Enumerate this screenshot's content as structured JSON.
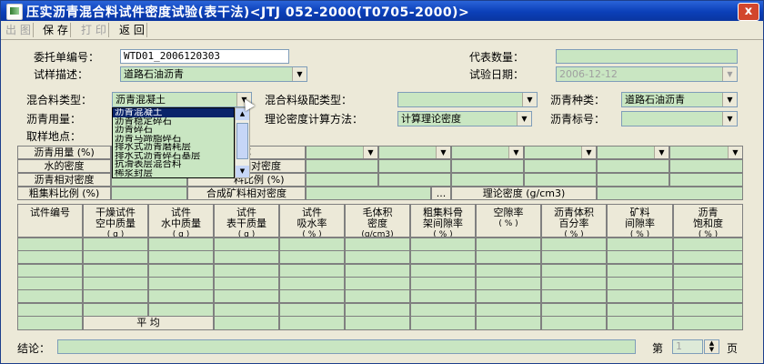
{
  "window": {
    "title": "压实沥青混合料试件密度试验(表干法)<JTJ 052-2000(T0705-2000)>",
    "close": "x"
  },
  "toolbar": {
    "out": "出 图",
    "save": "保 存",
    "print": "打 印",
    "back": "返 回"
  },
  "form": {
    "wt_label": "委托单编号：",
    "wt_value": "WTD01_2006120303",
    "desc_label": "试样描述：",
    "desc_value": "道路石油沥青",
    "rep_label": "代表数量：",
    "rep_value": "",
    "date_label": "试验日期：",
    "date_value": "2006-12-12",
    "mix_type_label": "混合料类型：",
    "mix_type_value": "沥青混凝土",
    "grade_label": "混合料级配类型：",
    "grade_value": "",
    "asp_kind_label": "沥青种类：",
    "asp_kind_value": "道路石油沥青",
    "asp_amt_label": "沥青用量：",
    "method_label": "理论密度计算方法：",
    "method_value": "计算理论密度",
    "asp_grade_label": "沥青标号：",
    "asp_grade_value": "",
    "site_label": "取样地点："
  },
  "dropdown": {
    "options": [
      "沥青混凝土",
      "沥青稳定碎石",
      "沥青碎石",
      "沥青马蹄脂碎石",
      "排水式沥青磨耗层",
      "排水式沥青碎石基层",
      "抗滑表层混合料",
      "稀浆封层"
    ],
    "selected": 0
  },
  "params": {
    "asp_amount": "沥青用量 (%)",
    "water_density": "水的密度",
    "asp_rel_density": "沥青相对密度",
    "coarse_ratio": "粗集料比例 (%)",
    "name_suffix": "称",
    "rel_density_suffix": "相对密度",
    "ratio_suffix": "料比例 (%)",
    "mineral_label": "合成矿料相对密度",
    "ellipsis": "...",
    "theory_label": "理论密度 (g/cm3)"
  },
  "table": {
    "headers": [
      {
        "l1": "试件编号",
        "l2": "",
        "unit": ""
      },
      {
        "l1": "干燥试件",
        "l2": "空中质量",
        "unit": "( g )"
      },
      {
        "l1": "试件",
        "l2": "水中质量",
        "unit": "( g )"
      },
      {
        "l1": "试件",
        "l2": "表干质量",
        "unit": "( g )"
      },
      {
        "l1": "试件",
        "l2": "吸水率",
        "unit": "( % )"
      },
      {
        "l1": "毛体积",
        "l2": "密度",
        "unit": "(g/cm3)"
      },
      {
        "l1": "粗集料骨",
        "l2": "架间隙率",
        "unit": "( % )"
      },
      {
        "l1": "空隙率",
        "l2": "",
        "unit": "( % )"
      },
      {
        "l1": "沥青体积",
        "l2": "百分率",
        "unit": "( % )"
      },
      {
        "l1": "矿料",
        "l2": "间隙率",
        "unit": "( % )"
      },
      {
        "l1": "沥青",
        "l2": "饱和度",
        "unit": "( % )"
      }
    ],
    "avg_label": "平        均"
  },
  "footer": {
    "conclusion_label": "结论：",
    "page_label": "第",
    "page_value": "1",
    "page_suffix": "页"
  }
}
